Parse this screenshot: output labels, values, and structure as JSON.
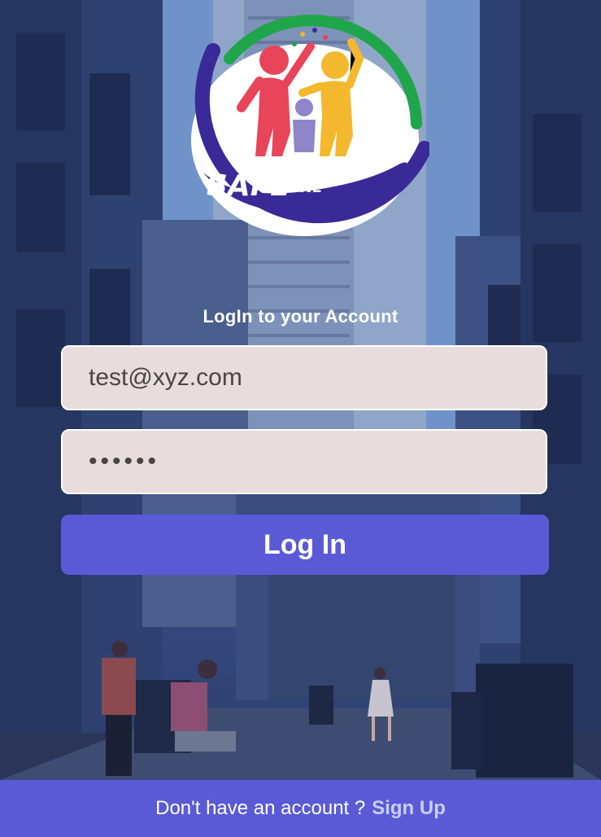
{
  "logo": {
    "word_1": "SAFE",
    "word_2": "ZONE"
  },
  "login": {
    "title": "LogIn to your Account",
    "email_value": "test@xyz.com",
    "password_value": "••••••",
    "button_label": "Log In"
  },
  "footer": {
    "prompt": "Don't have an account ?",
    "signup_label": "Sign Up"
  },
  "colors": {
    "accent": "#5b5ad6",
    "input_bg": "#e8dcdc"
  }
}
